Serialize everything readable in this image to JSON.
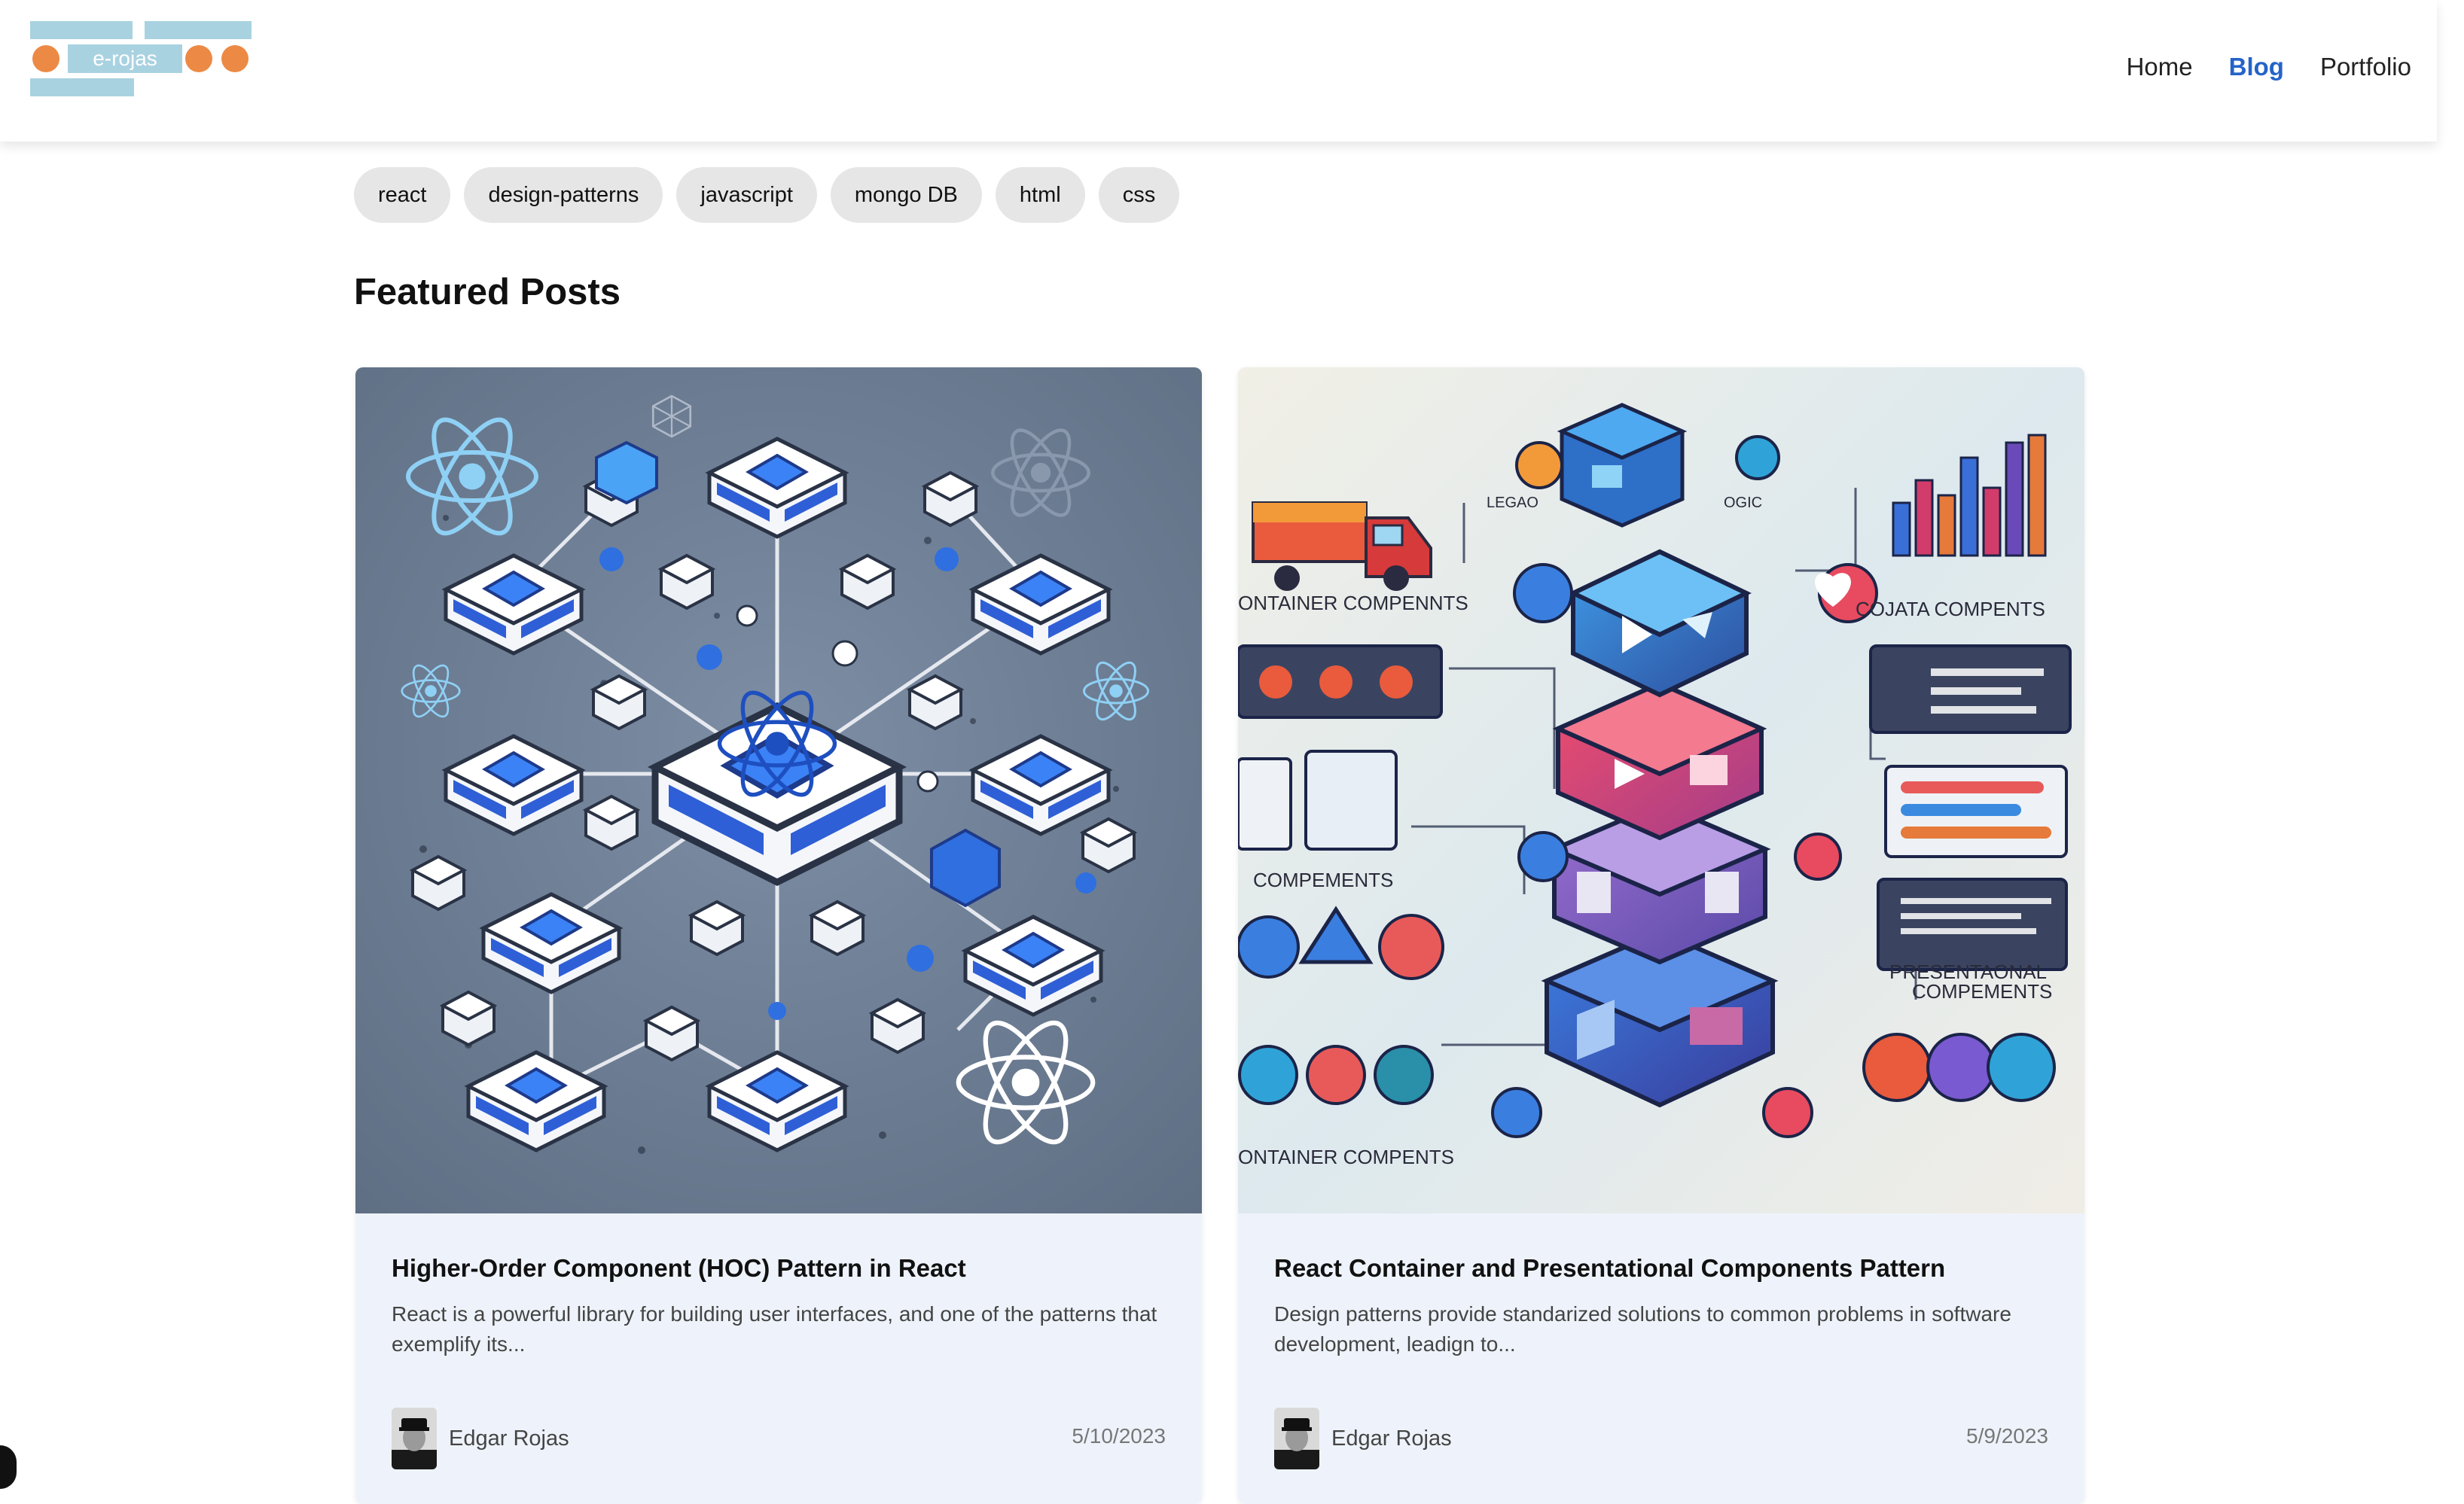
{
  "header": {
    "logo_text": "e-rojas",
    "nav": [
      {
        "label": "Home"
      },
      {
        "label": "Blog"
      },
      {
        "label": "Portfolio"
      }
    ]
  },
  "tags": [
    "react",
    "design-patterns",
    "javascript",
    "mongo DB",
    "html",
    "css"
  ],
  "featured": {
    "title": "Featured Posts",
    "posts": [
      {
        "title": "Higher-Order Component (HOC) Pattern in React",
        "excerpt": "React is a powerful library for building user interfaces, and one of the patterns that exemplify its...",
        "author": "Edgar Rojas",
        "date": "5/10/2023",
        "image_icon": "react-network-illustration"
      },
      {
        "title": "React Container and Presentational Components Pattern",
        "excerpt": "Design patterns provide standarized solutions to common problems in software development, leadign to...",
        "author": "Edgar Rojas",
        "date": "5/9/2023",
        "image_icon": "component-stack-illustration",
        "image_labels": [
          "ONTAINER COMPENNTS",
          "COJATA COMPENTS",
          "COMPEMENTS",
          "PRESENTAONAL",
          "COMPEMENTS",
          "ONTAINER COMPENTS",
          "LEGAO",
          "OGIC"
        ]
      }
    ]
  },
  "colors": {
    "accent": "#2563c9",
    "tag_bg": "#e6e6e6",
    "card_bg": "#eef3fb",
    "logo_blue": "#a9d2e1",
    "logo_orange": "#ec8a45"
  }
}
